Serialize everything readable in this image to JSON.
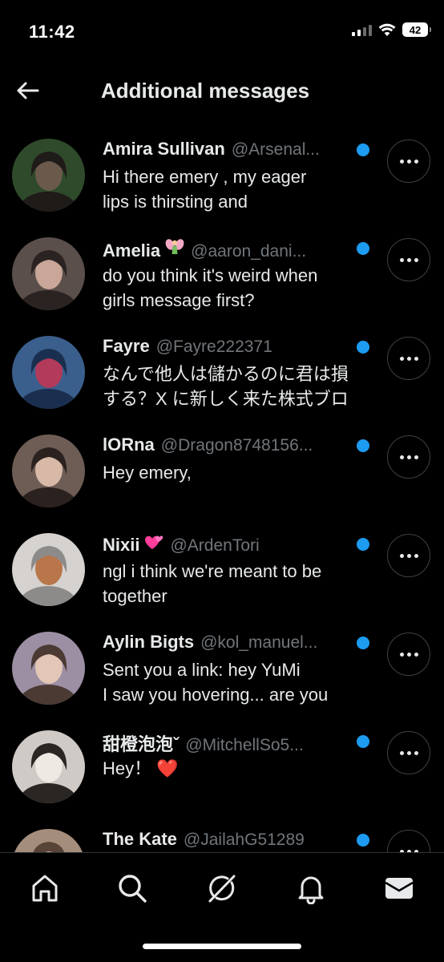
{
  "status": {
    "time": "11:42",
    "battery": "42"
  },
  "header": {
    "title": "Additional messages",
    "back_icon": "back-arrow-icon"
  },
  "messages": [
    {
      "name": "Amira Sullivan",
      "emoji": "",
      "handle": "@Arsenal...",
      "text": "Hi there emery  , my eager\nlips is thirsting and",
      "unread": true,
      "avatar_colors": [
        "#2e4a2a",
        "#6b5a4c",
        "#1f1b19"
      ]
    },
    {
      "name": "Amelia",
      "emoji": "fairy",
      "handle": "@aaron_dani...",
      "text": "do you think it's weird when\ngirls message first?",
      "unread": true,
      "avatar_colors": [
        "#5a4f4a",
        "#c9a697",
        "#2a2322"
      ]
    },
    {
      "name": "Fayre",
      "emoji": "",
      "handle": "@Fayre222371",
      "text": "なんで他人は儲かるのに君は損\nする？X に新しく来た株式ブロ",
      "unread": true,
      "avatar_colors": [
        "#3b5f8c",
        "#b23a5a",
        "#1a2f4f"
      ]
    },
    {
      "name": "lORna",
      "emoji": "",
      "handle": "@Dragon8748156...",
      "text": "Hey emery,",
      "unread": true,
      "avatar_colors": [
        "#6e5d55",
        "#d8b9a8",
        "#2b2220"
      ]
    },
    {
      "name": "Nixii",
      "emoji": "hearts",
      "handle": "@ArdenTori",
      "text": "ngl i think we're meant to be\ntogether",
      "unread": true,
      "avatar_colors": [
        "#d5d2cf",
        "#b8764a",
        "#8d8b8a"
      ]
    },
    {
      "name": "Aylin Bigts",
      "emoji": "",
      "handle": "@kol_manuel...",
      "text": "Sent you a link: hey YuMi\nI saw you hovering... are you",
      "unread": true,
      "avatar_colors": [
        "#9c8fa3",
        "#e3c6b5",
        "#4b3a33"
      ]
    },
    {
      "name": "甜橙泡泡ˇ",
      "emoji": "",
      "handle": "@MitchellSo5...",
      "text": "Hey！ ❤️",
      "unread": true,
      "avatar_colors": [
        "#cfcac6",
        "#efe9e4",
        "#2a2624"
      ]
    },
    {
      "name": "The Kate",
      "emoji": "",
      "handle": "@JailahG51289",
      "text": "",
      "unread": true,
      "avatar_colors": [
        "#a58d7c",
        "#d7b8a0",
        "#574437"
      ]
    }
  ],
  "tabs": [
    {
      "name": "home",
      "icon": "home-icon"
    },
    {
      "name": "search",
      "icon": "search-icon"
    },
    {
      "name": "grok",
      "icon": "grok-icon"
    },
    {
      "name": "notifications",
      "icon": "bell-icon"
    },
    {
      "name": "messages",
      "icon": "mail-icon"
    }
  ],
  "colors": {
    "accent": "#1d9bf0",
    "text": "#e7e9ea",
    "muted": "#71767b",
    "background": "#000000"
  }
}
